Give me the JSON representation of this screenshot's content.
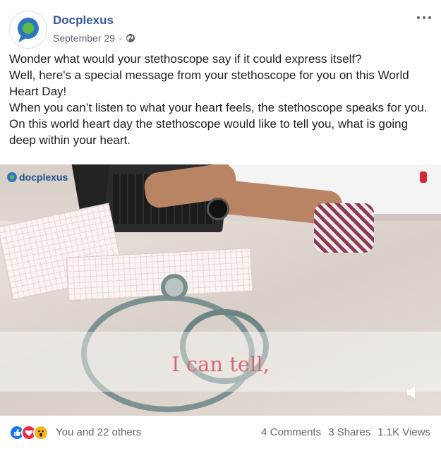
{
  "header": {
    "page_name": "Docplexus",
    "date": "September 29",
    "separator": "·",
    "more_label": "•••"
  },
  "post": {
    "paragraphs": [
      "Wonder what would your stethoscope say if it could express itself?",
      "Well, here's a special message from your stethoscope for you on this World Heart Day!",
      "When you can’t listen to what your heart feels, the stethoscope speaks for you. On this world heart day the stethoscope would like to tell you, what is going deep within your heart."
    ]
  },
  "video": {
    "watermark": "docplexus",
    "caption": "I can tell,"
  },
  "footer": {
    "reactions": [
      "like-icon",
      "love-icon",
      "wow-icon"
    ],
    "reaction_summary": "You and 22 others",
    "comments": "4 Comments",
    "shares": "3 Shares",
    "views": "1.1K Views"
  },
  "colors": {
    "brand_link": "#365899",
    "secondary_text": "#606770",
    "caption_pink": "#d46a70",
    "like_blue": "#1877f2",
    "love_red": "#f0284a",
    "wow_yellow": "#f7b125"
  }
}
